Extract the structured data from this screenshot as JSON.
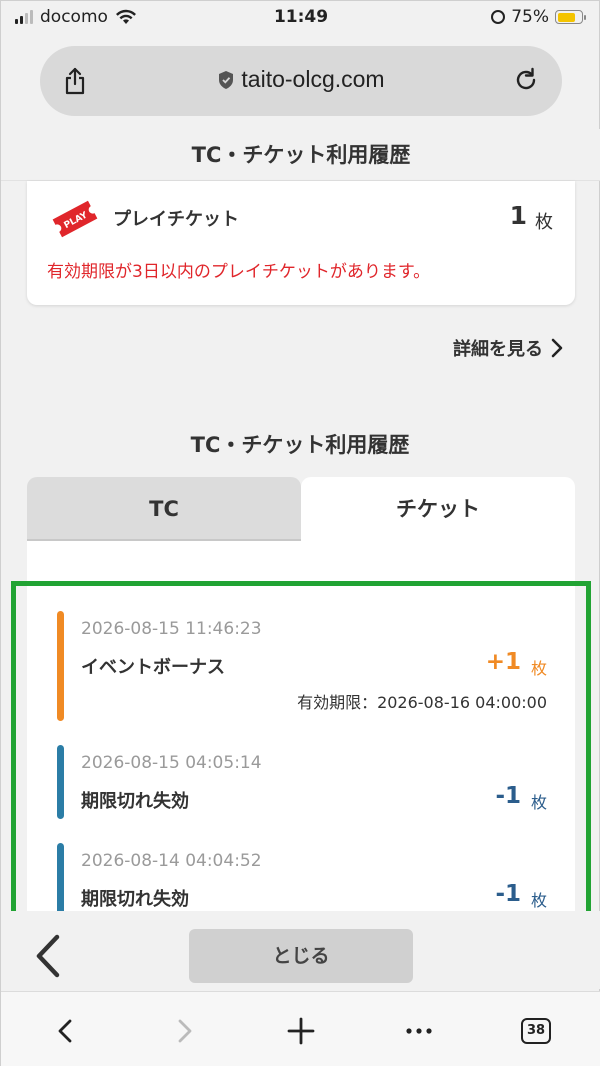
{
  "status_bar": {
    "carrier": "docomo",
    "time": "11:49",
    "battery_percent": "75%",
    "battery_level": 0.75,
    "signal_bars": 2
  },
  "browser": {
    "url": "taito-olcg.com",
    "open_tabs": "38"
  },
  "page": {
    "header_title": "TC・チケット利用履歴",
    "ticket": {
      "label": "プレイチケット",
      "icon_text": "PLAY",
      "count": "1",
      "unit": "枚",
      "warning": "有効期限が3日以内のプレイチケットがあります。"
    },
    "details_link": "詳細を見る",
    "history_title": "TC・チケット利用履歴",
    "tabs": [
      {
        "label": "TC",
        "active": false
      },
      {
        "label": "チケット",
        "active": true
      }
    ],
    "entries": [
      {
        "timestamp": "2026-08-15 11:46:23",
        "name": "イベントボーナス",
        "amount": "+1",
        "unit": "枚",
        "expiry": "有効期限：2026-08-16 04:00:00",
        "color": "#f08a24"
      },
      {
        "timestamp": "2026-08-15 04:05:14",
        "name": "期限切れ失効",
        "amount": "-1",
        "unit": "枚",
        "color": "#2b7da6"
      },
      {
        "timestamp": "2026-08-14 04:04:52",
        "name": "期限切れ失効",
        "amount": "-1",
        "unit": "枚",
        "color": "#2b7da6"
      }
    ],
    "close_button": "とじる"
  },
  "colors": {
    "warning_red": "#e0262b",
    "plus_orange": "#f08a24",
    "minus_blue": "#2b5d8c",
    "bar_blue": "#2b7da6",
    "highlight_green": "#21a333"
  }
}
